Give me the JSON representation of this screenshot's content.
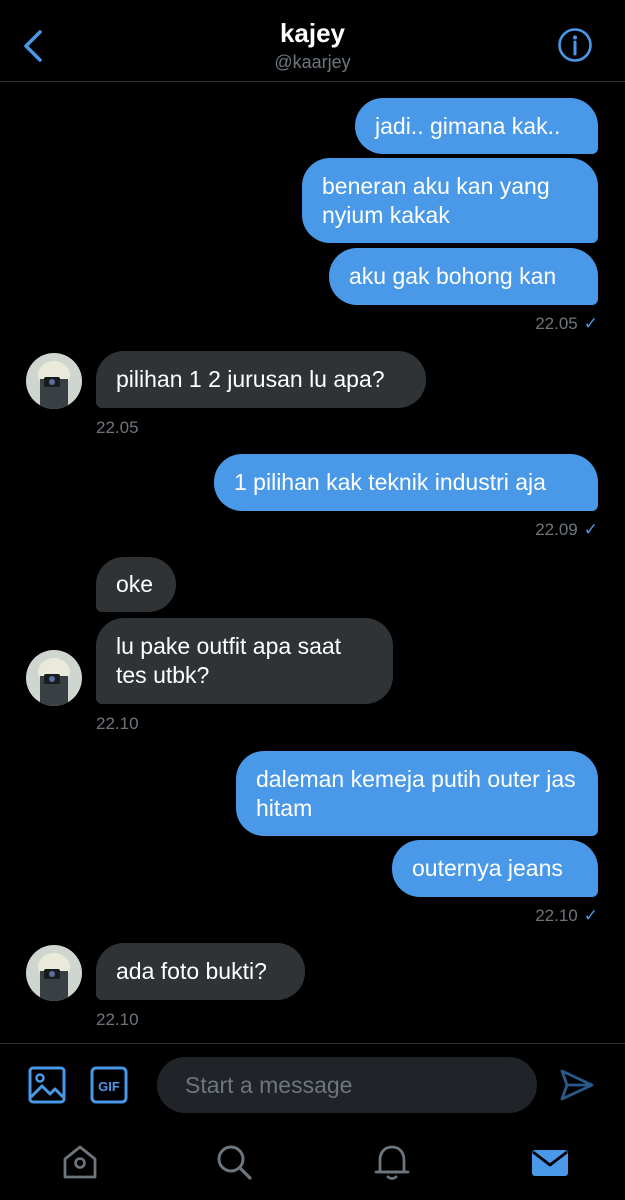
{
  "header": {
    "title": "kajey",
    "handle": "@kaarjey"
  },
  "messages": [
    {
      "text": "jadi.. gimana kak..",
      "direction": "outgoing"
    },
    {
      "text": "beneran aku kan yang nyium kakak",
      "direction": "outgoing"
    },
    {
      "text": "aku gak bohong kan",
      "direction": "outgoing"
    },
    {
      "text": "pilihan 1 2 jurusan lu apa?",
      "direction": "incoming"
    },
    {
      "text": "1 pilihan kak teknik industri aja",
      "direction": "outgoing"
    },
    {
      "text": "oke",
      "direction": "incoming"
    },
    {
      "text": "lu pake outfit apa saat tes utbk?",
      "direction": "incoming"
    },
    {
      "text": "daleman kemeja putih outer jas hitam",
      "direction": "outgoing"
    },
    {
      "text": "outernya jeans",
      "direction": "outgoing"
    },
    {
      "text": "ada foto bukti?",
      "direction": "incoming"
    }
  ],
  "timestamps": [
    "22.05",
    "22.05",
    "22.09",
    "22.10",
    "22.10",
    "22.10"
  ],
  "composer": {
    "placeholder": "Start a message",
    "gif_label": "GIF"
  },
  "colors": {
    "accent": "#4a99e9",
    "incoming_bubble": "#2f3336",
    "background": "#000000",
    "muted_text": "#6e767d"
  },
  "icons": [
    "back-arrow-icon",
    "info-icon",
    "image-icon",
    "gif-icon",
    "send-icon",
    "home-icon",
    "search-icon",
    "bell-icon",
    "mail-icon"
  ]
}
